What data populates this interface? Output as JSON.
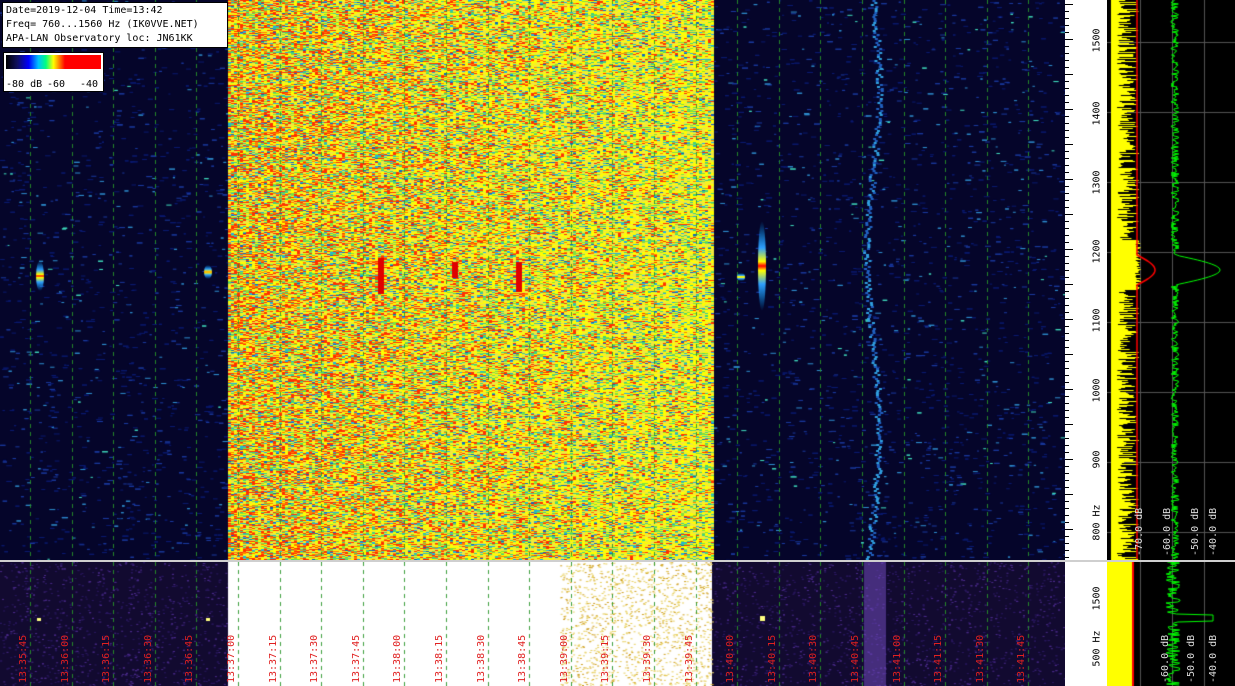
{
  "info": {
    "line1": "Date=2019-12-04 Time=13:42",
    "line2": "Freq= 760...1560 Hz (IK0VVE.NET)",
    "line3": "APA-LAN Observatory loc: JN61KK"
  },
  "colorbar": {
    "label_min": "-80 dB",
    "label_mid": "-60",
    "label_max": "-40"
  },
  "freq_axis": {
    "ticks": [
      "1500",
      "1400",
      "1300",
      "1200",
      "1100",
      "1000",
      "900",
      "800 Hz"
    ],
    "bottom_ticks": [
      "1500",
      "500 Hz"
    ]
  },
  "time_labels": [
    "13:35:45",
    "13:36:00",
    "13:36:15",
    "13:36:30",
    "13:36:45",
    "13:37:00",
    "13:37:15",
    "13:37:30",
    "13:37:45",
    "13:38:00",
    "13:38:15",
    "13:38:30",
    "13:38:45",
    "13:39:00",
    "13:39:15",
    "13:39:30",
    "13:39:45",
    "13:40:00",
    "13:40:15",
    "13:40:30",
    "13:40:45",
    "13:41:00",
    "13:41:15",
    "13:41:30",
    "13:41:45"
  ],
  "spectrum_labels": {
    "top": [
      "-70.0 dB",
      "-60.0 dB",
      "-50.0 dB",
      "-40.0 dB"
    ],
    "bottom": [
      "-60.0 dB",
      "-50.0 dB",
      "-40.0 dB"
    ]
  },
  "colors": {
    "background": "#000000",
    "spectrum_yellow": "#ffff00",
    "spectrum_green": "#00ff00",
    "spectrum_red": "#ff0000",
    "time_label": "#e02020",
    "grid_line": "#2a8a2a"
  }
}
